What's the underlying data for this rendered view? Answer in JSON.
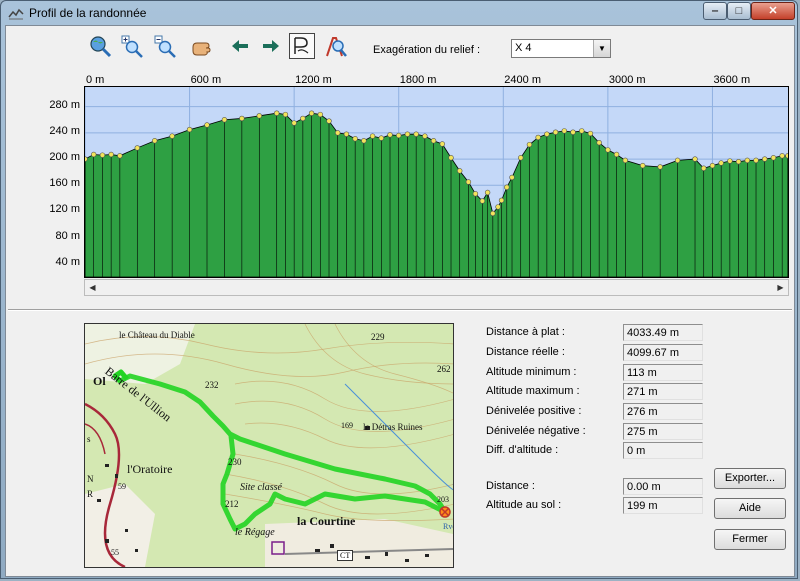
{
  "window": {
    "title": "Profil de la randonnée",
    "minimize_glyph": "‒",
    "maximize_glyph": "□",
    "close_glyph": "✕"
  },
  "toolbar": {
    "tools": [
      {
        "name": "zoom-extent-tool",
        "icon": "globe-magnifier-icon"
      },
      {
        "name": "zoom-in-tool",
        "icon": "zoom-in-icon"
      },
      {
        "name": "zoom-out-tool",
        "icon": "zoom-out-icon"
      },
      {
        "name": "pan-tool",
        "icon": "hand-icon"
      },
      {
        "name": "back-tool",
        "icon": "arrow-left-icon"
      },
      {
        "name": "forward-tool",
        "icon": "arrow-right-icon"
      },
      {
        "name": "profile-tool",
        "icon": "profile-path-icon",
        "pressed": true
      },
      {
        "name": "compass-zoom-tool",
        "icon": "compass-magnifier-icon"
      }
    ],
    "exaggeration_label": "Exagération du relief :",
    "exaggeration_value": "X 4"
  },
  "profile": {
    "x_ticks": [
      "0 m",
      "600 m",
      "1200 m",
      "1800 m",
      "2400 m",
      "3000 m",
      "3600 m"
    ],
    "y_ticks": [
      "280 m",
      "240 m",
      "200 m",
      "160 m",
      "120 m",
      "80 m",
      "40 m"
    ],
    "colors": {
      "sky": "#c4d8f8",
      "ground": "#2ea043",
      "grid": "#8fb0e0",
      "marker": "#f2e45c"
    }
  },
  "chart_data": {
    "type": "area",
    "xlabel": "",
    "ylabel": "",
    "xlim": [
      0,
      4033.49
    ],
    "ylim": [
      20,
      310
    ],
    "x_tick_values": [
      0,
      600,
      1200,
      1800,
      2400,
      3000,
      3600
    ],
    "y_tick_values": [
      280,
      240,
      200,
      160,
      120,
      80,
      40
    ],
    "x": [
      0,
      50,
      100,
      150,
      200,
      300,
      400,
      500,
      600,
      700,
      800,
      900,
      1000,
      1100,
      1150,
      1200,
      1250,
      1300,
      1350,
      1400,
      1450,
      1500,
      1550,
      1600,
      1650,
      1700,
      1750,
      1800,
      1850,
      1900,
      1950,
      2000,
      2050,
      2100,
      2150,
      2200,
      2240,
      2280,
      2310,
      2340,
      2370,
      2390,
      2420,
      2450,
      2500,
      2550,
      2600,
      2650,
      2700,
      2750,
      2800,
      2850,
      2900,
      2950,
      3000,
      3050,
      3100,
      3200,
      3300,
      3400,
      3500,
      3550,
      3600,
      3650,
      3700,
      3750,
      3800,
      3850,
      3900,
      3950,
      4000,
      4033
    ],
    "y": [
      200,
      207,
      206,
      207,
      205,
      217,
      228,
      235,
      245,
      252,
      260,
      262,
      266,
      270,
      268,
      255,
      262,
      270,
      268,
      258,
      240,
      238,
      231,
      228,
      235,
      232,
      237,
      236,
      238,
      238,
      235,
      228,
      223,
      202,
      182,
      165,
      147,
      136,
      149,
      117,
      127,
      137,
      157,
      172,
      202,
      222,
      233,
      238,
      241,
      243,
      241,
      243,
      239,
      225,
      214,
      207,
      198,
      190,
      188,
      198,
      200,
      186,
      190,
      194,
      197,
      196,
      198,
      198,
      200,
      202,
      205,
      205
    ]
  },
  "map": {
    "labels": {
      "chateau": "le Château du Diable",
      "barre": "Barre de l'Ullion",
      "oratoire": "l'Oratoire",
      "detras": "le Détras Ruines",
      "site": "Site classé",
      "courtine": "la Courtine",
      "regage": "le Régage",
      "rvoir": "Rvoir",
      "elev229": "229",
      "elev262": "262",
      "elev232": "232",
      "elev230": "230",
      "elev169": "169",
      "elev203": "203",
      "elev212": "212",
      "elev59": "59",
      "elev55": "55",
      "ct": "CT",
      "ol": "Ol",
      "r": "R",
      "n": "N",
      "s": "s"
    }
  },
  "stats": [
    {
      "label": "Distance à plat :",
      "value": "4033.49 m"
    },
    {
      "label": "Distance réelle :",
      "value": "4099.67 m"
    },
    {
      "label": "Altitude minimum :",
      "value": "113 m"
    },
    {
      "label": "Altitude maximum :",
      "value": "271 m"
    },
    {
      "label": "Dénivelée positive :",
      "value": "276 m"
    },
    {
      "label": "Dénivelée négative :",
      "value": "275 m"
    },
    {
      "label": "Diff. d'altitude :",
      "value": "0 m"
    }
  ],
  "cursor_stats": [
    {
      "label": "Distance :",
      "value": "0.00 m"
    },
    {
      "label": "Altitude au sol :",
      "value": "199 m"
    }
  ],
  "buttons": {
    "export": "Exporter...",
    "help": "Aide",
    "close": "Fermer"
  }
}
